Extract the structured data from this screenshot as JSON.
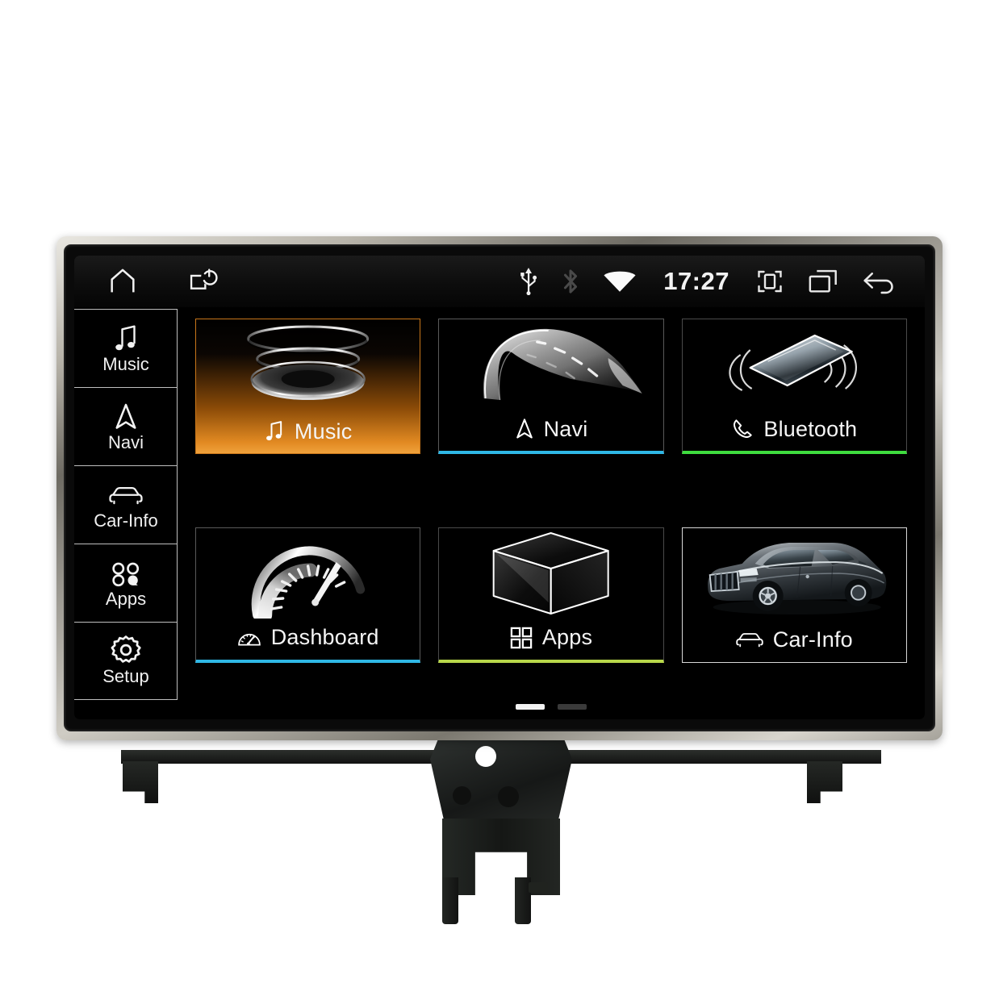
{
  "statusbar": {
    "left_icons": [
      {
        "name": "home-icon",
        "glyph": "home"
      },
      {
        "name": "power-screen-off-icon",
        "glyph": "screen-power"
      }
    ],
    "right_icons": [
      {
        "name": "usb-icon",
        "glyph": "usb"
      },
      {
        "name": "bluetooth-icon",
        "glyph": "bluetooth"
      },
      {
        "name": "wifi-icon",
        "glyph": "wifi"
      }
    ],
    "clock": "17:27",
    "nav_icons": [
      {
        "name": "screenshot-icon",
        "glyph": "crop-frame"
      },
      {
        "name": "recent-apps-icon",
        "glyph": "windows"
      },
      {
        "name": "back-icon",
        "glyph": "back-arrow"
      }
    ]
  },
  "sidebar": {
    "items": [
      {
        "label": "Music",
        "icon": "music-note-icon"
      },
      {
        "label": "Navi",
        "icon": "navigation-arrow-icon"
      },
      {
        "label": "Car-Info",
        "icon": "car-front-icon"
      },
      {
        "label": "Apps",
        "icon": "apps-circles-icon"
      },
      {
        "label": "Setup",
        "icon": "gear-icon"
      }
    ]
  },
  "main": {
    "tiles": [
      {
        "label": "Music",
        "icon": "music-note-icon",
        "accent": "#e28a22",
        "selected": true,
        "art": "vinyl-discs"
      },
      {
        "label": "Navi",
        "icon": "navigation-arrow-icon",
        "accent": "#2fb8e6",
        "selected": false,
        "art": "curved-road"
      },
      {
        "label": "Bluetooth",
        "icon": "phone-handset-icon",
        "accent": "#3fdc3f",
        "selected": false,
        "art": "phone-waves"
      },
      {
        "label": "Dashboard",
        "icon": "gauge-icon",
        "accent": "#2fb8e6",
        "selected": false,
        "art": "speedometer"
      },
      {
        "label": "Apps",
        "icon": "grid-squares-icon",
        "accent": "#b8d84a",
        "selected": false,
        "art": "wire-cube"
      },
      {
        "label": "Car-Info",
        "icon": "car-front-icon",
        "accent": "#d8d8d8",
        "selected": false,
        "art": "suv-photo"
      }
    ],
    "pager": {
      "pages": 2,
      "active": 1
    }
  },
  "colors": {
    "accent_orange": "#e28a22",
    "accent_cyan": "#2fb8e6",
    "accent_green": "#3fdc3f",
    "accent_lime": "#b8d84a",
    "accent_white": "#d8d8d8",
    "screen_bg": "#000000",
    "bezel": "#b9b5ab"
  }
}
